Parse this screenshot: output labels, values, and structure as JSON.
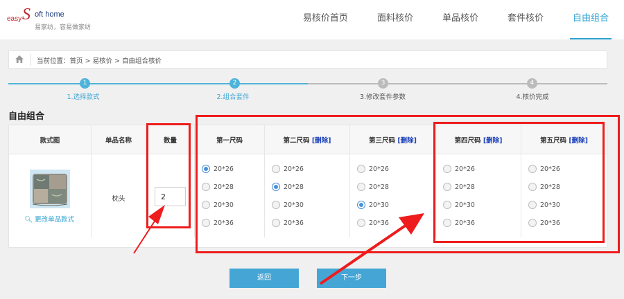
{
  "logo": {
    "easy": "easy",
    "s": "S",
    "home": "oft home",
    "slogan": "易家纺，容易做家纺"
  },
  "nav": {
    "items": [
      {
        "label": "易核价首页",
        "active": false
      },
      {
        "label": "面料核价",
        "active": false
      },
      {
        "label": "单品核价",
        "active": false
      },
      {
        "label": "套件核价",
        "active": false
      },
      {
        "label": "自由组合",
        "active": true
      }
    ]
  },
  "breadcrumb": {
    "icon": "home-icon",
    "text": "当前位置：首页 > 易核价 > 自由组合核价"
  },
  "steps": [
    {
      "number": "1",
      "label": "1.选择款式",
      "status": "done"
    },
    {
      "number": "2",
      "label": "2.组合套件",
      "status": "current"
    },
    {
      "number": "3",
      "label": "3.修改套件参数",
      "status": "todo"
    },
    {
      "number": "4",
      "label": "4.核价完成",
      "status": "todo"
    }
  ],
  "section_title": "自由组合",
  "table": {
    "headers": {
      "image": "款式图",
      "name": "单品名称",
      "quantity": "数量"
    },
    "size_columns": [
      {
        "label": "第一尺码",
        "delete": "",
        "selected": 0
      },
      {
        "label": "第二尺码",
        "delete": "[删除]",
        "selected": 1
      },
      {
        "label": "第三尺码",
        "delete": "[删除]",
        "selected": 2
      },
      {
        "label": "第四尺码",
        "delete": "[删除]",
        "selected": -1
      },
      {
        "label": "第五尺码",
        "delete": "[删除]",
        "selected": -1
      }
    ],
    "size_options": [
      "20*26",
      "20*28",
      "20*30",
      "20*36"
    ],
    "row": {
      "change_style": "更改单品款式",
      "name": "枕头",
      "quantity": "2"
    }
  },
  "buttons": {
    "back": "返回",
    "next": "下一步"
  },
  "colors": {
    "accent": "#2ea2d1",
    "step_done": "#4eb3d8",
    "step_todo": "#bbbbbb",
    "button": "#45a6d6",
    "annotation": "#ee1c1c",
    "delete_link": "#1a3fb8"
  }
}
